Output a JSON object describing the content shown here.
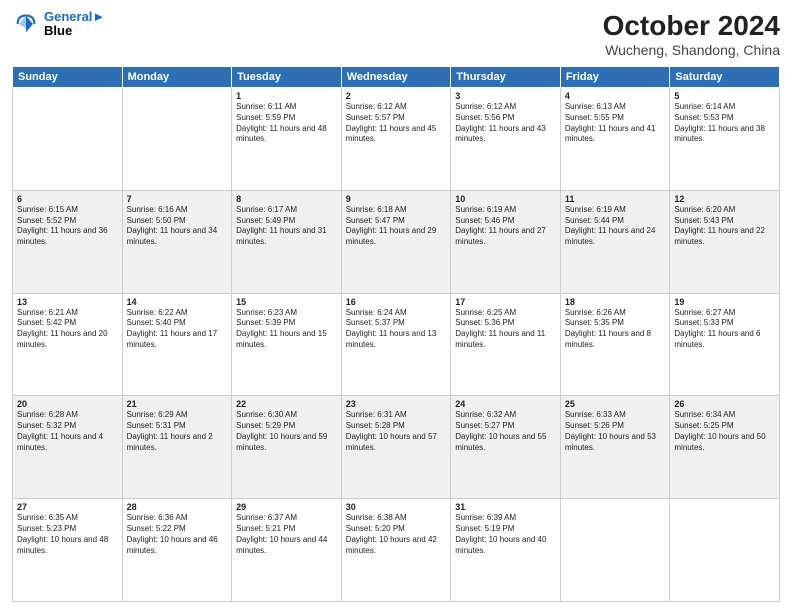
{
  "header": {
    "logo_line1": "General",
    "logo_line2": "Blue",
    "month": "October 2024",
    "location": "Wucheng, Shandong, China"
  },
  "days_of_week": [
    "Sunday",
    "Monday",
    "Tuesday",
    "Wednesday",
    "Thursday",
    "Friday",
    "Saturday"
  ],
  "weeks": [
    [
      {
        "day": "",
        "content": ""
      },
      {
        "day": "",
        "content": ""
      },
      {
        "day": "1",
        "content": "Sunrise: 6:11 AM\nSunset: 5:59 PM\nDaylight: 11 hours and 48 minutes."
      },
      {
        "day": "2",
        "content": "Sunrise: 6:12 AM\nSunset: 5:57 PM\nDaylight: 11 hours and 45 minutes."
      },
      {
        "day": "3",
        "content": "Sunrise: 6:12 AM\nSunset: 5:56 PM\nDaylight: 11 hours and 43 minutes."
      },
      {
        "day": "4",
        "content": "Sunrise: 6:13 AM\nSunset: 5:55 PM\nDaylight: 11 hours and 41 minutes."
      },
      {
        "day": "5",
        "content": "Sunrise: 6:14 AM\nSunset: 5:53 PM\nDaylight: 11 hours and 38 minutes."
      }
    ],
    [
      {
        "day": "6",
        "content": "Sunrise: 6:15 AM\nSunset: 5:52 PM\nDaylight: 11 hours and 36 minutes."
      },
      {
        "day": "7",
        "content": "Sunrise: 6:16 AM\nSunset: 5:50 PM\nDaylight: 11 hours and 34 minutes."
      },
      {
        "day": "8",
        "content": "Sunrise: 6:17 AM\nSunset: 5:49 PM\nDaylight: 11 hours and 31 minutes."
      },
      {
        "day": "9",
        "content": "Sunrise: 6:18 AM\nSunset: 5:47 PM\nDaylight: 11 hours and 29 minutes."
      },
      {
        "day": "10",
        "content": "Sunrise: 6:19 AM\nSunset: 5:46 PM\nDaylight: 11 hours and 27 minutes."
      },
      {
        "day": "11",
        "content": "Sunrise: 6:19 AM\nSunset: 5:44 PM\nDaylight: 11 hours and 24 minutes."
      },
      {
        "day": "12",
        "content": "Sunrise: 6:20 AM\nSunset: 5:43 PM\nDaylight: 11 hours and 22 minutes."
      }
    ],
    [
      {
        "day": "13",
        "content": "Sunrise: 6:21 AM\nSunset: 5:42 PM\nDaylight: 11 hours and 20 minutes."
      },
      {
        "day": "14",
        "content": "Sunrise: 6:22 AM\nSunset: 5:40 PM\nDaylight: 11 hours and 17 minutes."
      },
      {
        "day": "15",
        "content": "Sunrise: 6:23 AM\nSunset: 5:39 PM\nDaylight: 11 hours and 15 minutes."
      },
      {
        "day": "16",
        "content": "Sunrise: 6:24 AM\nSunset: 5:37 PM\nDaylight: 11 hours and 13 minutes."
      },
      {
        "day": "17",
        "content": "Sunrise: 6:25 AM\nSunset: 5:36 PM\nDaylight: 11 hours and 11 minutes."
      },
      {
        "day": "18",
        "content": "Sunrise: 6:26 AM\nSunset: 5:35 PM\nDaylight: 11 hours and 8 minutes."
      },
      {
        "day": "19",
        "content": "Sunrise: 6:27 AM\nSunset: 5:33 PM\nDaylight: 11 hours and 6 minutes."
      }
    ],
    [
      {
        "day": "20",
        "content": "Sunrise: 6:28 AM\nSunset: 5:32 PM\nDaylight: 11 hours and 4 minutes."
      },
      {
        "day": "21",
        "content": "Sunrise: 6:29 AM\nSunset: 5:31 PM\nDaylight: 11 hours and 2 minutes."
      },
      {
        "day": "22",
        "content": "Sunrise: 6:30 AM\nSunset: 5:29 PM\nDaylight: 10 hours and 59 minutes."
      },
      {
        "day": "23",
        "content": "Sunrise: 6:31 AM\nSunset: 5:28 PM\nDaylight: 10 hours and 57 minutes."
      },
      {
        "day": "24",
        "content": "Sunrise: 6:32 AM\nSunset: 5:27 PM\nDaylight: 10 hours and 55 minutes."
      },
      {
        "day": "25",
        "content": "Sunrise: 6:33 AM\nSunset: 5:26 PM\nDaylight: 10 hours and 53 minutes."
      },
      {
        "day": "26",
        "content": "Sunrise: 6:34 AM\nSunset: 5:25 PM\nDaylight: 10 hours and 50 minutes."
      }
    ],
    [
      {
        "day": "27",
        "content": "Sunrise: 6:35 AM\nSunset: 5:23 PM\nDaylight: 10 hours and 48 minutes."
      },
      {
        "day": "28",
        "content": "Sunrise: 6:36 AM\nSunset: 5:22 PM\nDaylight: 10 hours and 46 minutes."
      },
      {
        "day": "29",
        "content": "Sunrise: 6:37 AM\nSunset: 5:21 PM\nDaylight: 10 hours and 44 minutes."
      },
      {
        "day": "30",
        "content": "Sunrise: 6:38 AM\nSunset: 5:20 PM\nDaylight: 10 hours and 42 minutes."
      },
      {
        "day": "31",
        "content": "Sunrise: 6:39 AM\nSunset: 5:19 PM\nDaylight: 10 hours and 40 minutes."
      },
      {
        "day": "",
        "content": ""
      },
      {
        "day": "",
        "content": ""
      }
    ]
  ]
}
